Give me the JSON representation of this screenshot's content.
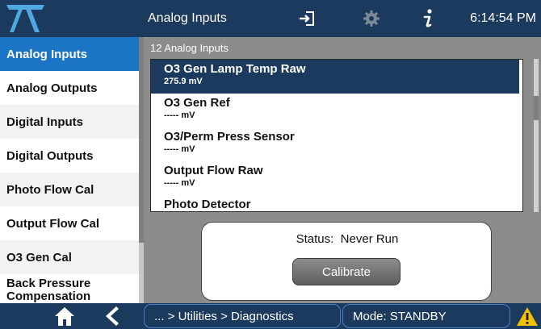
{
  "header": {
    "title": "Analog Inputs",
    "time": "6:14:54 PM",
    "icons": [
      "logo-icon",
      "exit-icon",
      "gear-icon",
      "info-icon"
    ]
  },
  "sidebar": {
    "items": [
      {
        "label": "Analog Inputs",
        "active": true
      },
      {
        "label": "Analog Outputs"
      },
      {
        "label": "Digital Inputs"
      },
      {
        "label": "Digital Outputs"
      },
      {
        "label": "Photo Flow Cal"
      },
      {
        "label": "Output Flow Cal"
      },
      {
        "label": "O3 Gen Cal"
      },
      {
        "label_line1": "Back Pressure",
        "label_line2": "Compensation"
      }
    ]
  },
  "main": {
    "count_label": "12 Analog Inputs",
    "list": [
      {
        "name": "O3 Gen Lamp Temp Raw",
        "value": "275.9 mV",
        "selected": true
      },
      {
        "name": "O3 Gen Ref",
        "value": "----- mV"
      },
      {
        "name": "O3/Perm Press Sensor",
        "value": "----- mV"
      },
      {
        "name": "Output Flow Raw",
        "value": "----- mV"
      },
      {
        "name": "Photo Detector",
        "value": ""
      }
    ],
    "status": {
      "label": "Status:",
      "value": "Never Run",
      "button_label": "Calibrate"
    }
  },
  "footer": {
    "breadcrumb": "... > Utilities > Diagnostics",
    "mode": "Mode: STANDBY",
    "icons": [
      "home-icon",
      "back-icon",
      "warning-icon"
    ]
  },
  "colors": {
    "navy": "#1c3a5e",
    "accent_blue": "#1b74c4",
    "panel_gray": "#8c8c8c",
    "warning_yellow": "#f2c200"
  }
}
